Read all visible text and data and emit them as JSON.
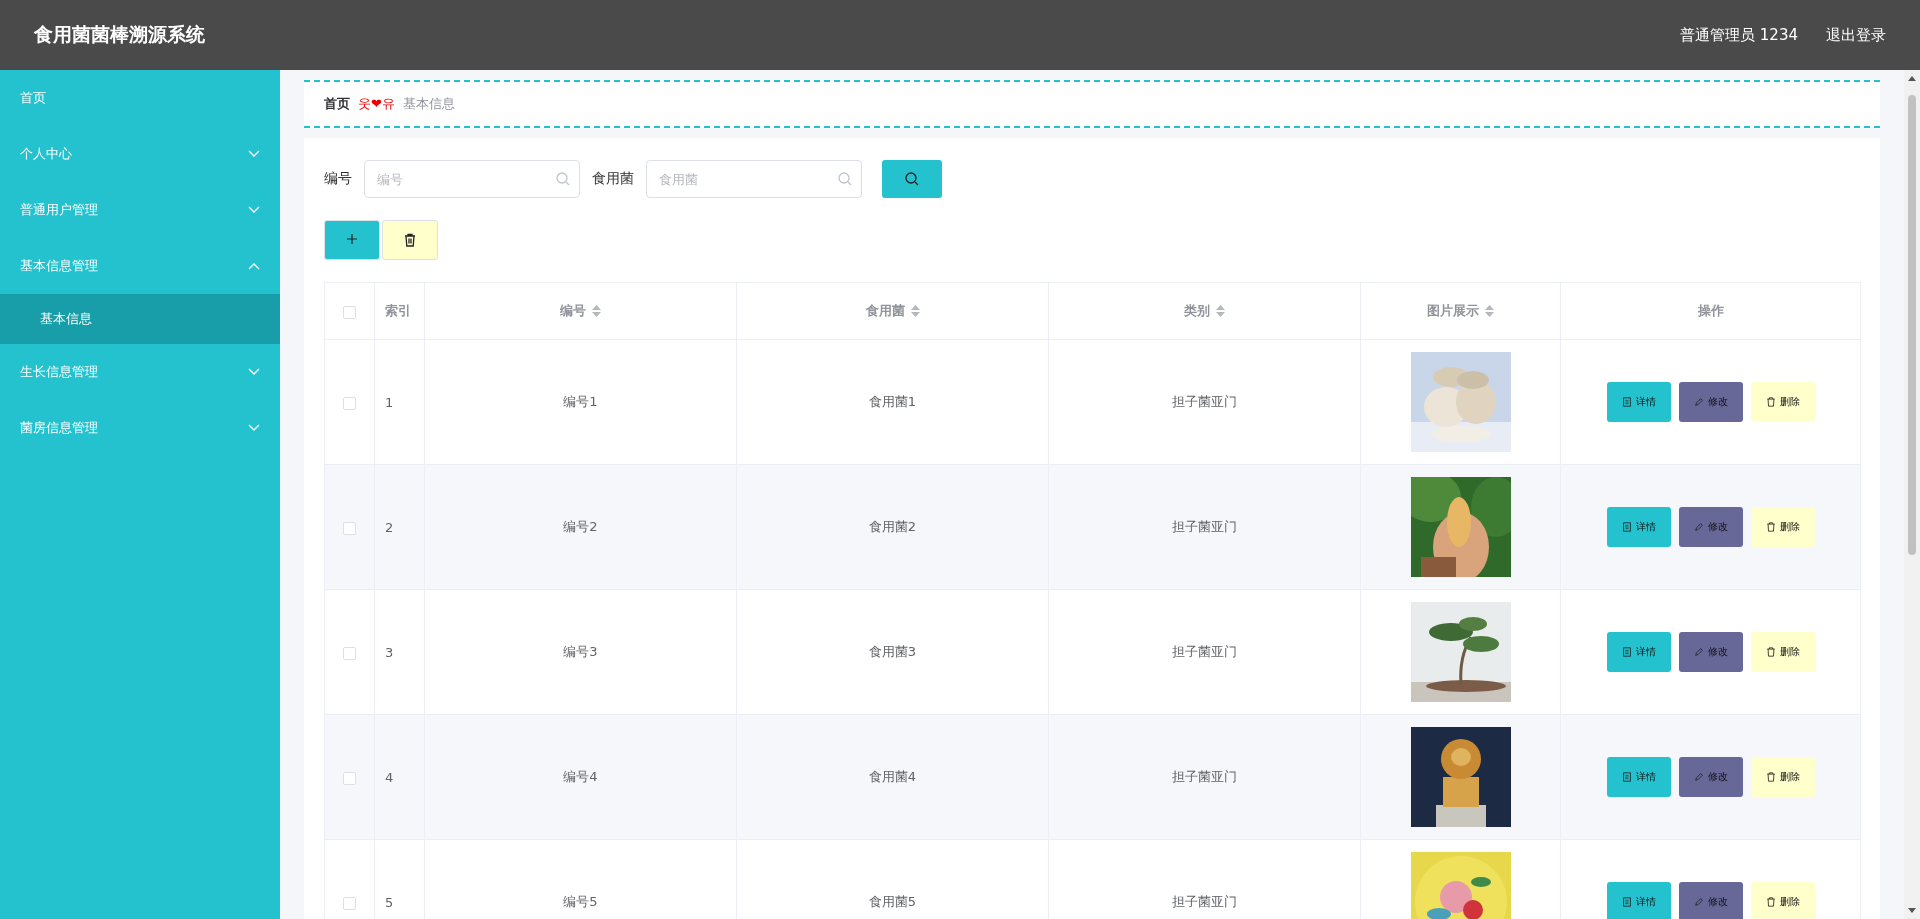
{
  "header": {
    "title": "食用菌菌棒溯源系统",
    "user": "普通管理员 1234",
    "logout": "退出登录"
  },
  "sidebar": {
    "items": [
      {
        "label": "首页",
        "selected": false
      },
      {
        "label": "个人中心",
        "expanded": false,
        "selected": false
      },
      {
        "label": "普通用户管理",
        "expanded": false,
        "selected": false
      },
      {
        "label": "基本信息管理",
        "expanded": true,
        "selected": false,
        "children": [
          {
            "label": "基本信息",
            "selected": true
          }
        ]
      },
      {
        "label": "生长信息管理",
        "expanded": false,
        "selected": false
      },
      {
        "label": "菌房信息管理",
        "expanded": false,
        "selected": false
      }
    ]
  },
  "breadcrumb": {
    "home": "首页",
    "separator": "웃❤유",
    "current": "基本信息"
  },
  "search": {
    "fields": [
      {
        "label": "编号",
        "placeholder": "编号"
      },
      {
        "label": "食用菌",
        "placeholder": "食用菌"
      }
    ]
  },
  "table": {
    "columns": [
      {
        "label": "索引",
        "sortable": false
      },
      {
        "label": "编号",
        "sortable": true
      },
      {
        "label": "食用菌",
        "sortable": true
      },
      {
        "label": "类别",
        "sortable": true
      },
      {
        "label": "图片展示",
        "sortable": true
      },
      {
        "label": "操作",
        "sortable": false
      }
    ],
    "header_checked": false,
    "rows": [
      {
        "checked": false,
        "index": "1",
        "code": "编号1",
        "fungus": "食用菌1",
        "category": "担子菌亚门",
        "actions": [
          "详情",
          "修改",
          "删除"
        ]
      },
      {
        "checked": false,
        "index": "2",
        "code": "编号2",
        "fungus": "食用菌2",
        "category": "担子菌亚门",
        "actions": [
          "详情",
          "修改",
          "删除"
        ]
      },
      {
        "checked": false,
        "index": "3",
        "code": "编号3",
        "fungus": "食用菌3",
        "category": "担子菌亚门",
        "actions": [
          "详情",
          "修改",
          "删除"
        ]
      },
      {
        "checked": false,
        "index": "4",
        "code": "编号4",
        "fungus": "食用菌4",
        "category": "担子菌亚门",
        "actions": [
          "详情",
          "修改",
          "删除"
        ]
      },
      {
        "checked": false,
        "index": "5",
        "code": "编号5",
        "fungus": "食用菌5",
        "category": "担子菌亚门",
        "actions": [
          "详情",
          "修改",
          "删除"
        ]
      }
    ]
  }
}
